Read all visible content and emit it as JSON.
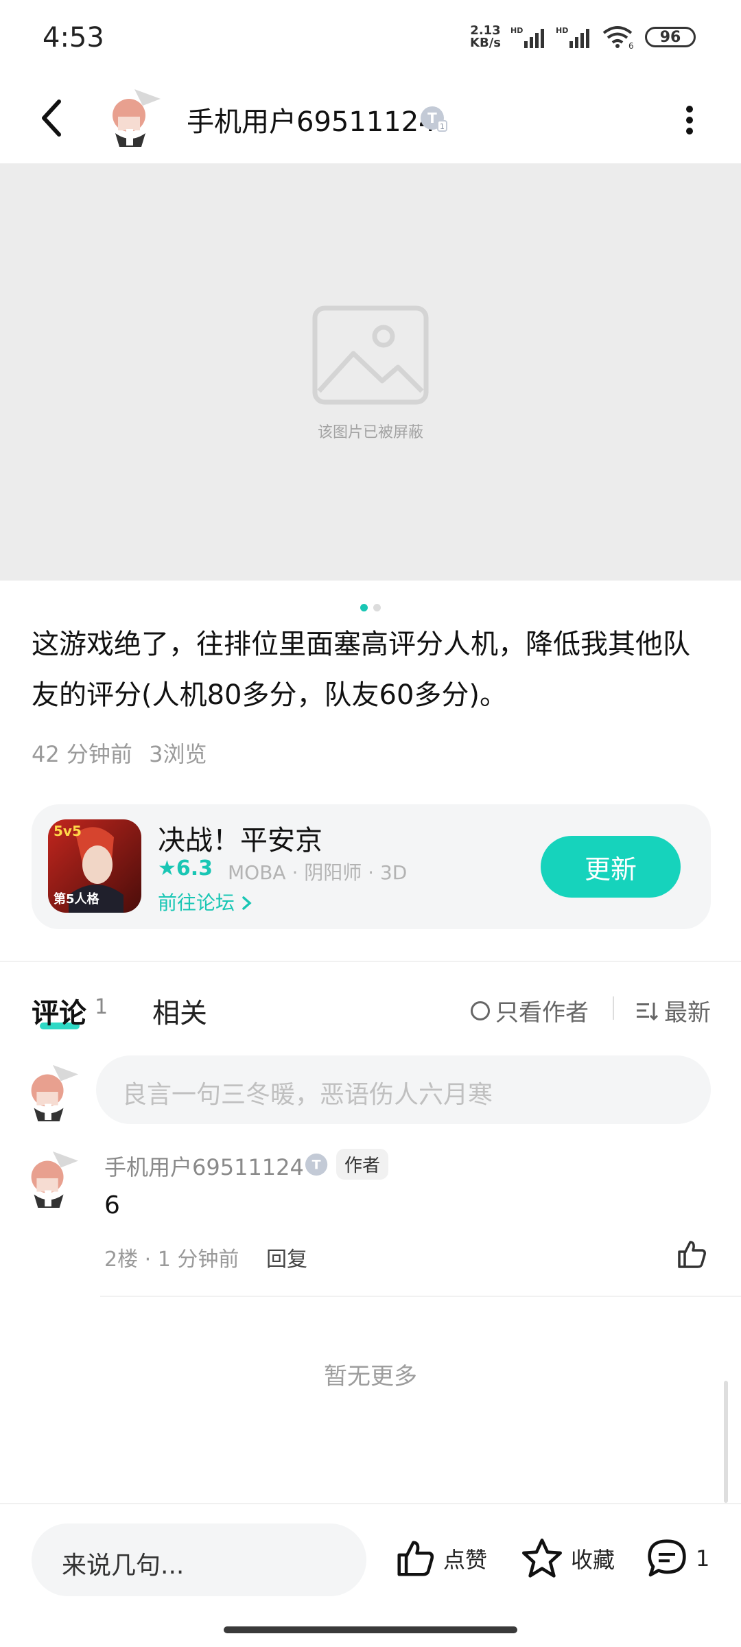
{
  "status_bar": {
    "time": "4:53",
    "net_speed_value": "2.13",
    "net_speed_unit": "KB/s",
    "hd1": "HD",
    "hd2": "HD",
    "wifi_badge": "6",
    "battery": "96"
  },
  "header": {
    "username": "手机用户69511124",
    "badge_letter": "T",
    "badge_level": "1"
  },
  "media": {
    "placeholder_text": "该图片已被屏蔽",
    "page_count": 2,
    "active_index": 0
  },
  "post": {
    "text": "这游戏绝了，往排位里面塞高评分人机，降低我其他队友的评分(人机80多分，队友60多分)。",
    "time": "42 分钟前",
    "views": "3浏览"
  },
  "game_card": {
    "title": "决战！平安京",
    "rating": "6.3",
    "tags": "MOBA · 阴阳师 · 3D",
    "forum_link": "前往论坛",
    "update_label": "更新",
    "icon_caption_top": "5v5",
    "icon_caption_bottom": "第5人格"
  },
  "tabs": {
    "comments_label": "评论",
    "comments_count": "1",
    "related_label": "相关",
    "author_only_label": "只看作者",
    "sort_label": "最新"
  },
  "comment_input": {
    "placeholder": "良言一句三冬暖，恶语伤人六月寒"
  },
  "comments": [
    {
      "user": "手机用户69511124",
      "badge_letter": "T",
      "author_tag": "作者",
      "text": "6",
      "meta": "2楼 · 1 分钟前",
      "reply_label": "回复"
    }
  ],
  "no_more": "暂无更多",
  "bottom_bar": {
    "input_placeholder": "来说几句...",
    "like_label": "点赞",
    "favorite_label": "收藏",
    "comment_count": "1"
  },
  "colors": {
    "accent": "#16d3bc",
    "rating": "#19c6b4"
  },
  "icons": [
    "back-icon",
    "more-icon",
    "image-placeholder-icon",
    "star-icon",
    "chevron-right-icon",
    "radio-icon",
    "sort-icon",
    "thumbs-up-icon",
    "star-outline-icon",
    "comment-icon"
  ]
}
